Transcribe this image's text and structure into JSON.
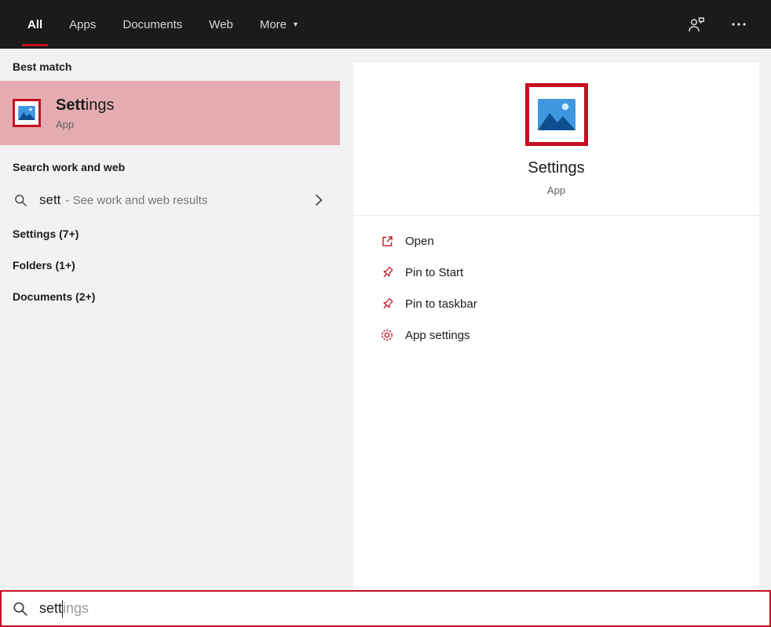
{
  "colors": {
    "accent": "#c50f1f",
    "highlight": "rgba(197,15,31,0.31)",
    "topbar_bg": "#1b1b1b",
    "panel_bg": "#f2f2f2"
  },
  "topbar": {
    "tabs": [
      {
        "label": "All",
        "selected": true
      },
      {
        "label": "Apps",
        "selected": false
      },
      {
        "label": "Documents",
        "selected": false
      },
      {
        "label": "Web",
        "selected": false
      },
      {
        "label": "More",
        "selected": false,
        "has_dropdown": true
      }
    ],
    "icons": [
      "feedback-icon",
      "more-options-icon"
    ]
  },
  "left_panel": {
    "best_match_header": "Best match",
    "best_match": {
      "title_match": "Sett",
      "title_rest": "ings",
      "subtitle": "App"
    },
    "search_web_header": "Search work and web",
    "web_suggestion": {
      "query": "sett",
      "hint": "- See work and web results"
    },
    "groups": [
      {
        "label": "Settings (7+)"
      },
      {
        "label": "Folders (1+)"
      },
      {
        "label": "Documents (2+)"
      }
    ]
  },
  "preview_panel": {
    "app_name": "Settings",
    "app_type": "App",
    "actions": [
      {
        "icon": "open-icon",
        "label": "Open"
      },
      {
        "icon": "pin-icon",
        "label": "Pin to Start"
      },
      {
        "icon": "pin-icon",
        "label": "Pin to taskbar"
      },
      {
        "icon": "gear-icon",
        "label": "App settings"
      }
    ]
  },
  "search_bar": {
    "typed": "sett",
    "completion": "ings"
  }
}
